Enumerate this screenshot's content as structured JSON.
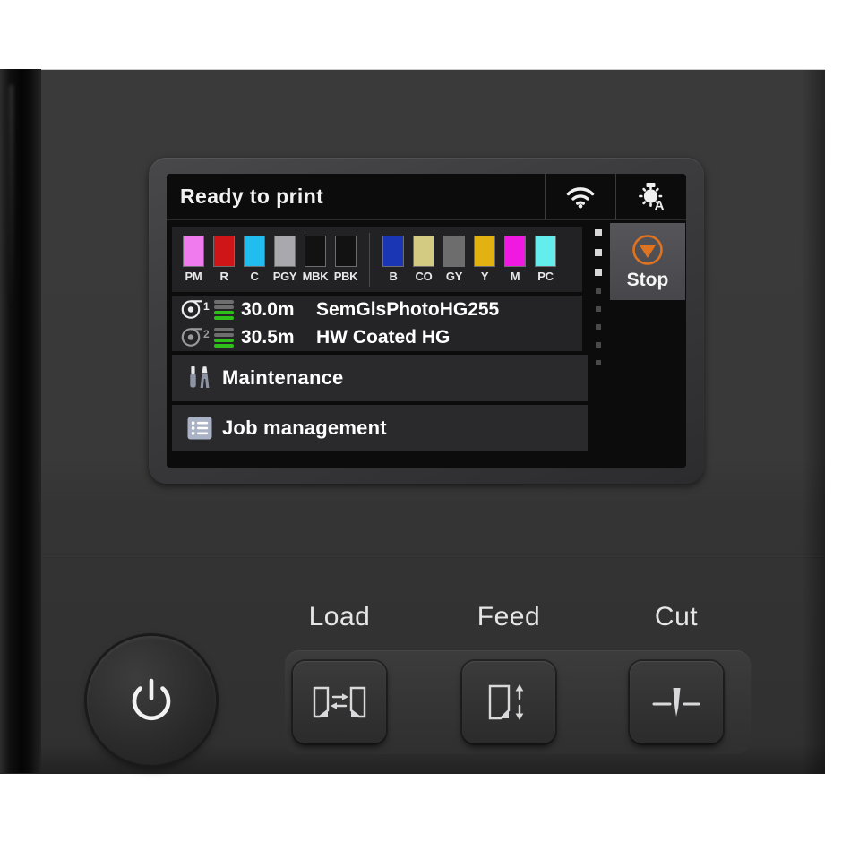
{
  "device": {
    "name": "large-format-printer-control-panel"
  },
  "lcd": {
    "status_bar": {
      "status_text": "Ready to print",
      "wifi_icon": "wifi-icon",
      "lamp_icon": "auto-lamp-icon",
      "lamp_letter": "A"
    },
    "ink_panel": {
      "group_left": [
        {
          "code": "PM",
          "color": "#ef7bee"
        },
        {
          "code": "R",
          "color": "#cf1517"
        },
        {
          "code": "C",
          "color": "#21bdee"
        },
        {
          "code": "PGY",
          "color": "#a9a9ad"
        },
        {
          "code": "MBK",
          "color": "#121212"
        },
        {
          "code": "PBK",
          "color": "#121212"
        }
      ],
      "group_right": [
        {
          "code": "B",
          "color": "#1b36b4"
        },
        {
          "code": "CO",
          "color": "#d3cb82"
        },
        {
          "code": "GY",
          "color": "#6d6d6d"
        },
        {
          "code": "Y",
          "color": "#e2b310"
        },
        {
          "code": "M",
          "color": "#ef19e2"
        },
        {
          "code": "PC",
          "color": "#64eded"
        }
      ]
    },
    "rolls": [
      {
        "icon": "roll-1-icon",
        "number": "1",
        "length": "30.0m",
        "media": "SemGlsPhotoHG255"
      },
      {
        "icon": "roll-2-icon",
        "number": "2",
        "length": "30.5m",
        "media": "HW Coated HG"
      }
    ],
    "menu_items": [
      {
        "icon": "maintenance-icon",
        "label": "Maintenance"
      },
      {
        "icon": "job-management-icon",
        "label": "Job management"
      }
    ],
    "side_panel": {
      "stop_button": {
        "label": "Stop",
        "icon": "stop-icon",
        "color": "#e0731f"
      },
      "scroll_dots_active": 3,
      "scroll_dots_inactive": 5
    }
  },
  "hardware_buttons": {
    "power": {
      "name": "power-button",
      "icon": "power-icon"
    },
    "keys": [
      {
        "label": "Load",
        "icon": "load-media-icon"
      },
      {
        "label": "Feed",
        "icon": "feed-media-icon"
      },
      {
        "label": "Cut",
        "icon": "cut-media-icon"
      }
    ]
  }
}
